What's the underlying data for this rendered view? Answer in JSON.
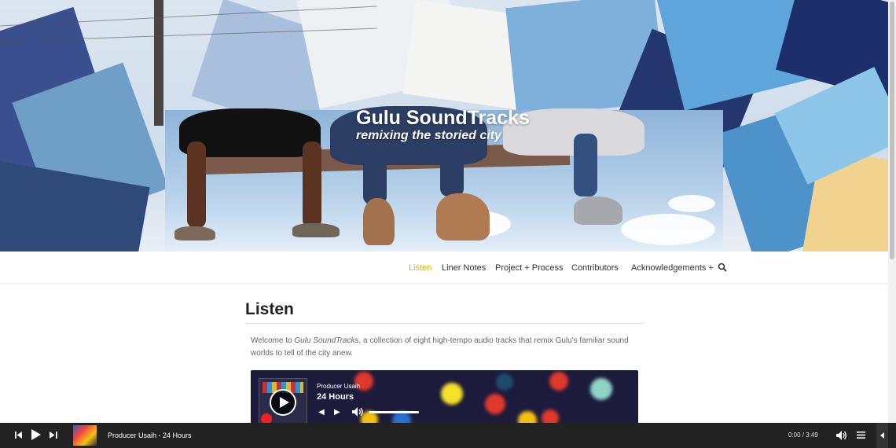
{
  "hero": {
    "title": "Gulu SoundTracks",
    "subtitle": "remixing the storied city"
  },
  "nav": {
    "items": [
      {
        "label": "Listen",
        "active": true
      },
      {
        "label": "Liner Notes",
        "active": false
      },
      {
        "label": "Project + Process",
        "active": false
      },
      {
        "label": "Contributors",
        "active": false
      },
      {
        "label": "Acknowledgements +",
        "active": false
      }
    ],
    "search_icon": "search-icon",
    "active_color": "#d9b600"
  },
  "main": {
    "title": "Listen",
    "intro_prefix": "Welcome to ",
    "intro_em": "Gulu SoundTracks",
    "intro_suffix": ", a collection of eight high-tempo audio tracks that remix Gulu's familiar sound worlds to tell of the city anew."
  },
  "embed": {
    "artist": "Producer Usaih",
    "track": "24 Hours",
    "volume": 1.0
  },
  "player_bar": {
    "now_playing": "Producer Usaih - 24 Hours",
    "time": "0:00 / 3:49",
    "icons": [
      "previous-icon",
      "play-icon",
      "next-icon",
      "volume-icon",
      "playlist-icon",
      "collapse-icon"
    ]
  }
}
